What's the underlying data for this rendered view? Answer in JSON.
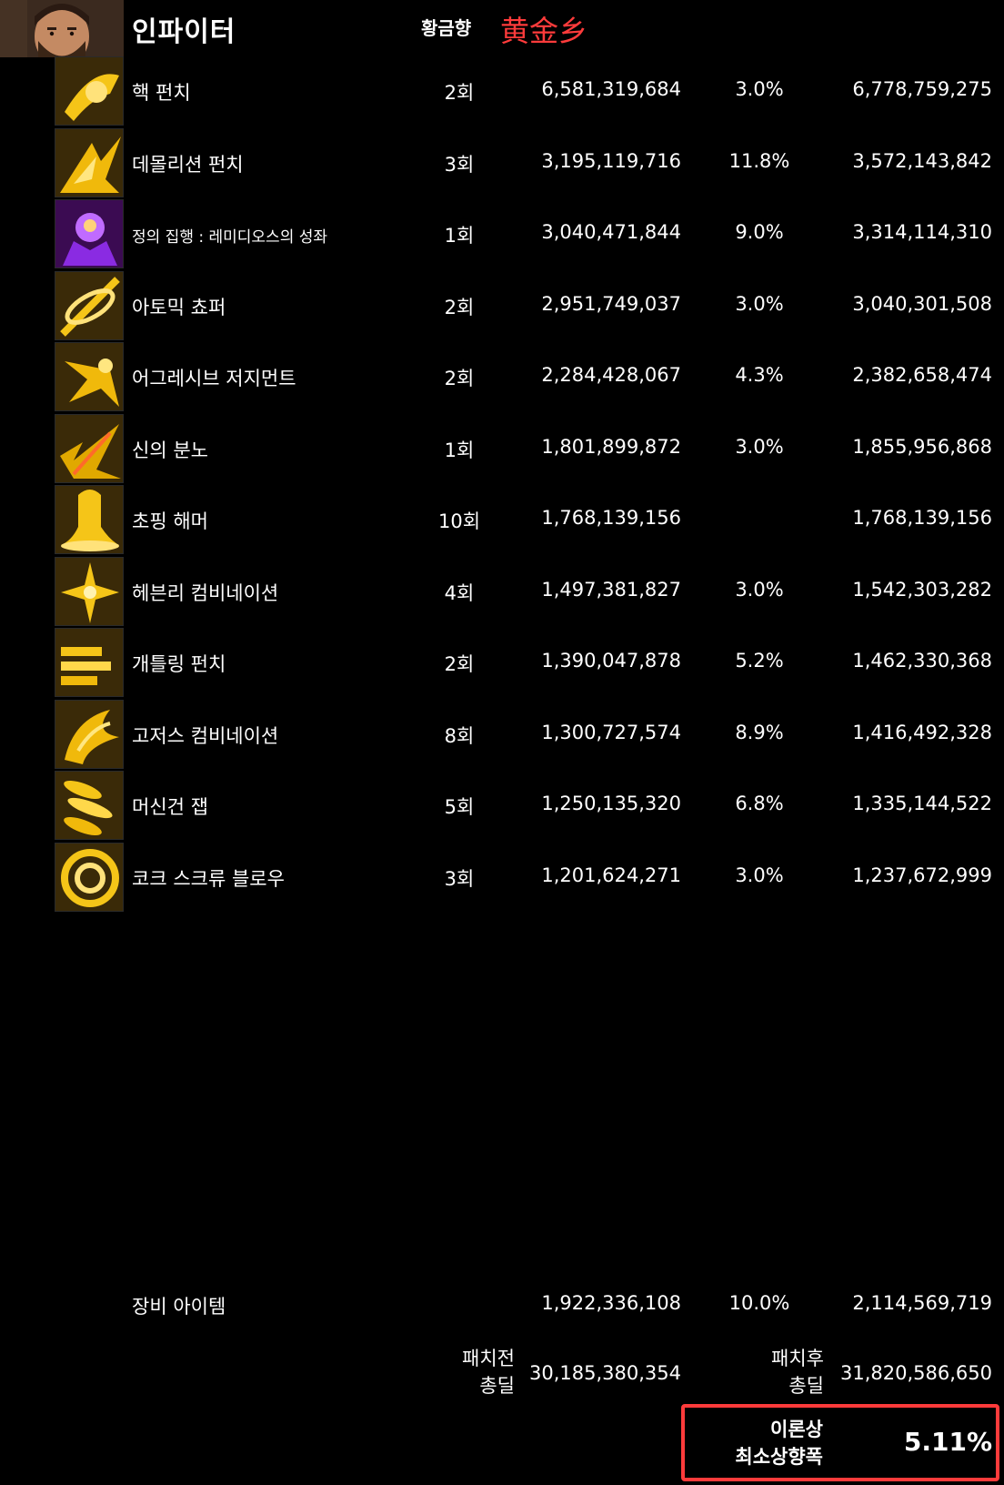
{
  "header": {
    "avatar_icon": "character-portrait-icon",
    "class_name": "인파이터",
    "server": "황금향",
    "guild": "黄金乡",
    "guild_color": "#ff3b3b"
  },
  "skills": [
    {
      "icon": "heart-punch-icon",
      "palette": "gold",
      "name": "핵 펀치",
      "hits": "2회",
      "base": "6,581,319,684",
      "pct": "3.0%",
      "after": "6,778,759,275"
    },
    {
      "icon": "demolition-punch-icon",
      "palette": "gold",
      "name": "데몰리션 펀치",
      "hits": "3회",
      "base": "3,195,119,716",
      "pct": "11.8%",
      "after": "3,572,143,842"
    },
    {
      "icon": "justice-execution-icon",
      "palette": "purple",
      "name": "정의 집행 : 레미디오스의 성좌",
      "hits": "1회",
      "base": "3,040,471,844",
      "pct": "9.0%",
      "after": "3,314,114,310"
    },
    {
      "icon": "atomic-chopper-icon",
      "palette": "gold",
      "name": "아토믹 쵸퍼",
      "hits": "2회",
      "base": "2,951,749,037",
      "pct": "3.0%",
      "after": "3,040,301,508"
    },
    {
      "icon": "aggressive-judgment-icon",
      "palette": "gold",
      "name": "어그레시브 저지먼트",
      "hits": "2회",
      "base": "2,284,428,067",
      "pct": "4.3%",
      "after": "2,382,658,474"
    },
    {
      "icon": "divine-wrath-icon",
      "palette": "gold",
      "name": "신의 분노",
      "hits": "1회",
      "base": "1,801,899,872",
      "pct": "3.0%",
      "after": "1,855,956,868"
    },
    {
      "icon": "chopping-hammer-icon",
      "palette": "gold",
      "name": "초핑 해머",
      "hits": "10회",
      "base": "1,768,139,156",
      "pct": "",
      "after": "1,768,139,156"
    },
    {
      "icon": "heavenly-combination-icon",
      "palette": "gold",
      "name": "헤븐리 컴비네이션",
      "hits": "4회",
      "base": "1,497,381,827",
      "pct": "3.0%",
      "after": "1,542,303,282"
    },
    {
      "icon": "gatling-punch-icon",
      "palette": "gold",
      "name": "개틀링 펀치",
      "hits": "2회",
      "base": "1,390,047,878",
      "pct": "5.2%",
      "after": "1,462,330,368"
    },
    {
      "icon": "gauges-combination-icon",
      "palette": "gold",
      "name": "고저스 컴비네이션",
      "hits": "8회",
      "base": "1,300,727,574",
      "pct": "8.9%",
      "after": "1,416,492,328"
    },
    {
      "icon": "machine-gun-jab-icon",
      "palette": "gold",
      "name": "머신건 잽",
      "hits": "5회",
      "base": "1,250,135,320",
      "pct": "6.8%",
      "after": "1,335,144,522"
    },
    {
      "icon": "cork-screw-blow-icon",
      "palette": "gold",
      "name": "코크 스크류 블로우",
      "hits": "3회",
      "base": "1,201,624,271",
      "pct": "3.0%",
      "after": "1,237,672,999"
    }
  ],
  "equipment": {
    "name": "장비 아이템",
    "base": "1,922,336,108",
    "pct": "10.0%",
    "after": "2,114,569,719"
  },
  "totals": {
    "pre_label_line1": "패치전",
    "pre_label_line2": "총딜",
    "pre_value": "30,185,380,354",
    "post_label_line1": "패치후",
    "post_label_line2": "총딜",
    "post_value": "31,820,586,650"
  },
  "summary": {
    "label_line1": "이론상",
    "label_line2": "최소상향폭",
    "value": "5.11%",
    "border_color": "#ff3b3b"
  }
}
